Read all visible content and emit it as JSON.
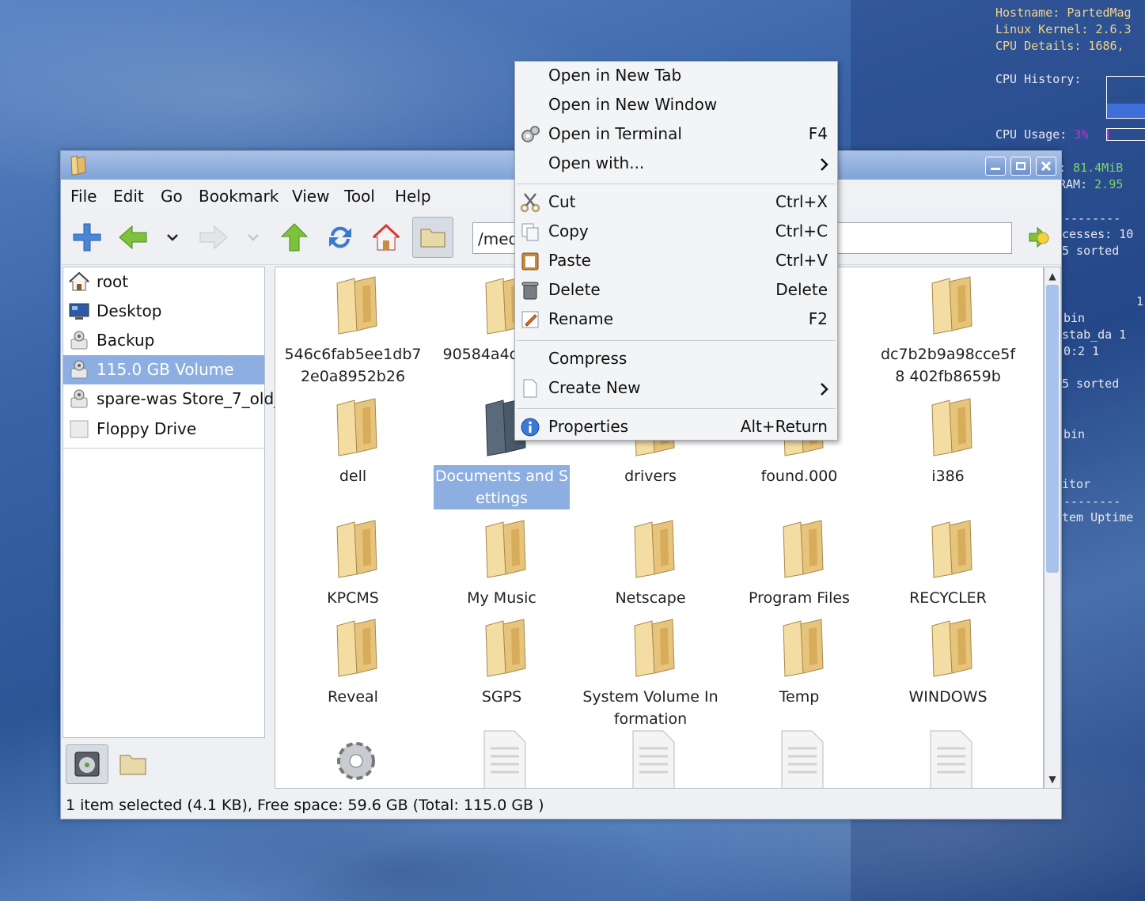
{
  "conky": {
    "hostname_label": "Hostname:",
    "hostname_value": "PartedMag",
    "kernel_label": "Linux Kernel:",
    "kernel_value": "2.6.3",
    "cpu_details_label": "CPU Details:",
    "cpu_details_value": "1686,",
    "cpu_history_label": "CPU History:",
    "cpu_usage_label": "CPU Usage:",
    "cpu_usage_value": "3%",
    "cpu_usage_fraction": 0.03,
    "mem_label": ":",
    "mem_value": "81.4MiB",
    "ram_label": "RAM:",
    "ram_value": "2.95",
    "dashes": "--------",
    "processes": "cesses: 10",
    "sorted1": "5 sorted",
    "num1": "1",
    "bin1": "bin",
    "stab": "stab_da  1",
    "t02": "0:2      1",
    "sorted2": "5 sorted",
    "bin2": "bin",
    "monitor": "itor",
    "dashes2": "--------",
    "uptime": "tem Uptime"
  },
  "menubar": {
    "file": "File",
    "edit": "Edit",
    "go": "Go",
    "bookmark": "Bookmark",
    "view": "View",
    "tool": "Tool",
    "help": "Help"
  },
  "address": {
    "value": "/media/sda1"
  },
  "sidebar": {
    "items": [
      {
        "label": "root",
        "icon": "home-icon"
      },
      {
        "label": "Desktop",
        "icon": "desktop-icon"
      },
      {
        "label": "Backup",
        "icon": "drive-icon"
      },
      {
        "label": "115.0 GB Volume",
        "icon": "drive-icon"
      },
      {
        "label": "spare-was Store_7_old_",
        "icon": "drive-icon"
      },
      {
        "label": "Floppy Drive",
        "icon": "floppy-icon"
      }
    ],
    "selected_index": 3
  },
  "files": [
    {
      "name": "546c6fab5ee1db7 2e0a8952b26"
    },
    {
      "name": "90584a4c7 607"
    },
    {
      "name": ""
    },
    {
      "name": ""
    },
    {
      "name": "dc7b2b9a98cce5f8 402fb8659b"
    },
    {
      "name": "dell"
    },
    {
      "name": "Documents and Settings"
    },
    {
      "name": "drivers"
    },
    {
      "name": "found.000"
    },
    {
      "name": "i386"
    },
    {
      "name": "KPCMS"
    },
    {
      "name": "My Music"
    },
    {
      "name": "Netscape"
    },
    {
      "name": "Program Files"
    },
    {
      "name": "RECYCLER"
    },
    {
      "name": "Reveal"
    },
    {
      "name": "SGPS"
    },
    {
      "name": "System Volume Information"
    },
    {
      "name": "Temp"
    },
    {
      "name": "WINDOWS"
    }
  ],
  "status": {
    "text": "1 item selected (4.1 KB), Free space: 59.6 GB (Total: 115.0 GB )"
  },
  "context_menu": {
    "open_new_tab": "Open in New Tab",
    "open_new_window": "Open in New Window",
    "open_terminal": "Open in Terminal",
    "open_terminal_shortcut": "F4",
    "open_with": "Open with...",
    "cut": "Cut",
    "cut_shortcut": "Ctrl+X",
    "copy": "Copy",
    "copy_shortcut": "Ctrl+C",
    "paste": "Paste",
    "paste_shortcut": "Ctrl+V",
    "delete": "Delete",
    "delete_shortcut": "Delete",
    "rename": "Rename",
    "rename_shortcut": "F2",
    "compress": "Compress",
    "create_new": "Create New",
    "properties": "Properties",
    "properties_shortcut": "Alt+Return"
  },
  "colors": {
    "selection": "#8caee0",
    "titlebar": "#7fa2d8",
    "folder": "#e8c98a"
  }
}
